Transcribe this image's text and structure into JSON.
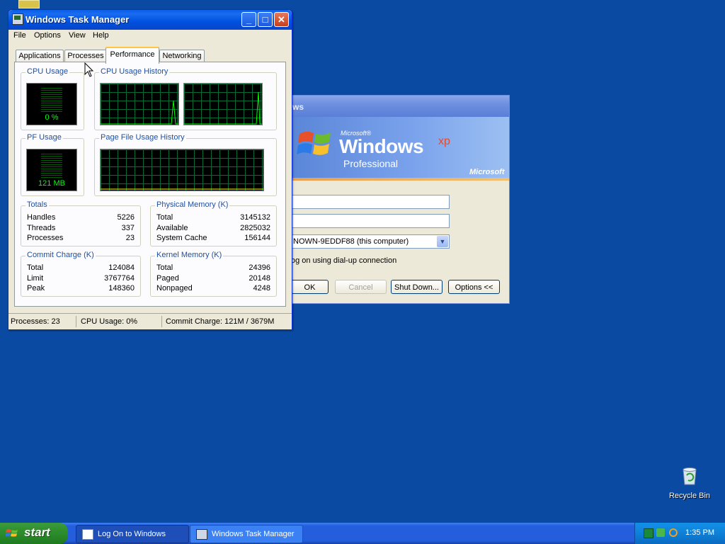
{
  "logon": {
    "title_fragment": "ws",
    "brand_microsoft_small": "Microsoft®",
    "brand_windows": "Windows",
    "brand_xp": "xp",
    "brand_edition": "Professional",
    "brand_microsoft": "Microsoft",
    "field1_value": "",
    "field2_value": "",
    "domain_value": "NOWN-9EDDF88 (this computer)",
    "dialup_label": "og on using dial-up connection",
    "ok_label": "OK",
    "cancel_label": "Cancel",
    "shutdown_label": "Shut Down...",
    "options_label": "Options <<"
  },
  "taskmgr": {
    "title": "Windows Task Manager",
    "menu": [
      "File",
      "Options",
      "View",
      "Help"
    ],
    "tabs": [
      "Applications",
      "Processes",
      "Performance",
      "Networking"
    ],
    "active_tab": "Performance",
    "cpu_usage_label": "CPU Usage",
    "cpu_usage_value": "0 %",
    "cpu_history_label": "CPU Usage History",
    "pf_usage_label": "PF Usage",
    "pf_usage_value": "121 MB",
    "pf_history_label": "Page File Usage History",
    "totals": {
      "label": "Totals",
      "rows": [
        {
          "k": "Handles",
          "v": "5226"
        },
        {
          "k": "Threads",
          "v": "337"
        },
        {
          "k": "Processes",
          "v": "23"
        }
      ]
    },
    "physical": {
      "label": "Physical Memory (K)",
      "rows": [
        {
          "k": "Total",
          "v": "3145132"
        },
        {
          "k": "Available",
          "v": "2825032"
        },
        {
          "k": "System Cache",
          "v": "156144"
        }
      ]
    },
    "commit": {
      "label": "Commit Charge (K)",
      "rows": [
        {
          "k": "Total",
          "v": "124084"
        },
        {
          "k": "Limit",
          "v": "3767764"
        },
        {
          "k": "Peak",
          "v": "148360"
        }
      ]
    },
    "kernel": {
      "label": "Kernel Memory (K)",
      "rows": [
        {
          "k": "Total",
          "v": "24396"
        },
        {
          "k": "Paged",
          "v": "20148"
        },
        {
          "k": "Nonpaged",
          "v": "4248"
        }
      ]
    },
    "status": {
      "processes": "Processes: 23",
      "cpu": "CPU Usage: 0%",
      "commit": "Commit Charge: 121M / 3679M"
    }
  },
  "desktop": {
    "recycle_bin_label": "Recycle Bin"
  },
  "taskbar": {
    "start_label": "start",
    "items": [
      "Log On to Windows",
      "Windows Task Manager"
    ],
    "clock": "1:35 PM"
  },
  "colors": {
    "desktop": "#0b4aa3",
    "graph_green": "#00ff00",
    "title_blue": "#0050e0",
    "start_green": "#2e8f2e"
  },
  "icons": [
    "task-manager-icon",
    "windows-flag-icon",
    "recycle-bin-icon",
    "tray-network-icon",
    "tray-update-icon",
    "tray-search-icon"
  ]
}
